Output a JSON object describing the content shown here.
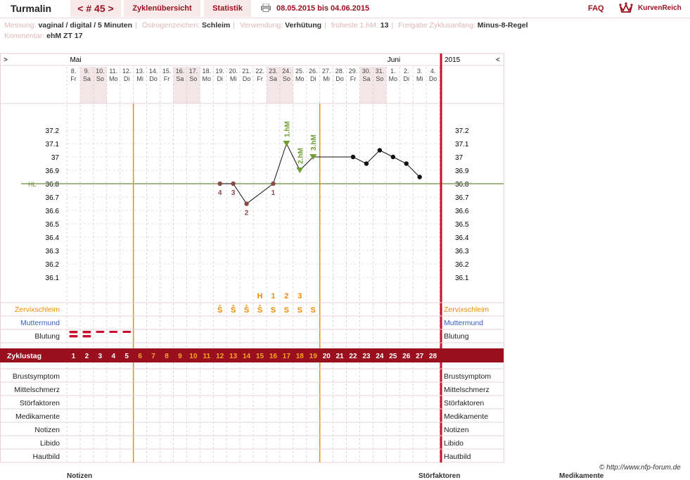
{
  "header": {
    "title": "Turmalin",
    "cycle_nav": "< # 45 >",
    "tab_overview": "Zyklenübersicht",
    "tab_stats": "Statistik",
    "date_range": "08.05.2015 bis 04.06.2015",
    "faq": "FAQ",
    "brand": "KurvenReich"
  },
  "info": {
    "messung_label": "Messung:",
    "messung_value": "vaginal / digital / 5 Minuten",
    "oestro_label": "Östrogenzeichen:",
    "oestro_value": "Schleim",
    "verw_label": "Verwendung:",
    "verw_value": "Verhütung",
    "hm_label": "früheste 1.hM:",
    "hm_value": "13",
    "freigabe_label": "Freigabe Zyklusanfang:",
    "freigabe_value": "Minus-8-Regel",
    "komm_label": "Kommentar:",
    "komm_value": "ehM ZT 17"
  },
  "chart_data": {
    "type": "line",
    "month_left": "Mai",
    "month_right": "Juni",
    "year": "2015",
    "nav_left": ">",
    "nav_right": "<",
    "days": [
      {
        "d": "8.",
        "w": "Fr"
      },
      {
        "d": "9.",
        "w": "Sa"
      },
      {
        "d": "10.",
        "w": "So"
      },
      {
        "d": "11.",
        "w": "Mo"
      },
      {
        "d": "12.",
        "w": "Di"
      },
      {
        "d": "13.",
        "w": "Mi"
      },
      {
        "d": "14.",
        "w": "Do"
      },
      {
        "d": "15.",
        "w": "Fr"
      },
      {
        "d": "16.",
        "w": "Sa"
      },
      {
        "d": "17.",
        "w": "So"
      },
      {
        "d": "18.",
        "w": "Mo"
      },
      {
        "d": "19.",
        "w": "Di"
      },
      {
        "d": "20.",
        "w": "Mi"
      },
      {
        "d": "21.",
        "w": "Do"
      },
      {
        "d": "22.",
        "w": "Fr"
      },
      {
        "d": "23.",
        "w": "Sa"
      },
      {
        "d": "24.",
        "w": "So"
      },
      {
        "d": "25.",
        "w": "Mo"
      },
      {
        "d": "26.",
        "w": "Di"
      },
      {
        "d": "27.",
        "w": "Mi"
      },
      {
        "d": "28.",
        "w": "Do"
      },
      {
        "d": "29.",
        "w": "Fr"
      },
      {
        "d": "30.",
        "w": "Sa"
      },
      {
        "d": "31.",
        "w": "So"
      },
      {
        "d": "1.",
        "w": "Mo"
      },
      {
        "d": "2.",
        "w": "Di"
      },
      {
        "d": "3.",
        "w": "Mi"
      },
      {
        "d": "4.",
        "w": "Do"
      }
    ],
    "weekend_days": [
      2,
      3,
      9,
      10,
      16,
      17,
      23,
      24
    ],
    "cycle_days": [
      1,
      2,
      3,
      4,
      5,
      6,
      7,
      8,
      9,
      10,
      11,
      12,
      13,
      14,
      15,
      16,
      17,
      18,
      19,
      20,
      21,
      22,
      23,
      24,
      25,
      26,
      27,
      28
    ],
    "ylim": [
      36.0,
      37.3
    ],
    "y_ticks": [
      "37.2",
      "37.1",
      "37",
      "36.9",
      "36.8",
      "36.7",
      "36.6",
      "36.5",
      "36.4",
      "36.3",
      "36.2",
      "36.1"
    ],
    "hl_label": "HL",
    "hl_value": 36.8,
    "temps": [
      {
        "cd": 12,
        "t": 36.8,
        "label": "4"
      },
      {
        "cd": 13,
        "t": 36.8,
        "label": "3"
      },
      {
        "cd": 14,
        "t": 36.65,
        "label": "2"
      },
      {
        "cd": 16,
        "t": 36.8,
        "label": "1"
      },
      {
        "cd": 17,
        "t": 37.1,
        "hm": "1.hM"
      },
      {
        "cd": 18,
        "t": 36.9,
        "hm": "2.hM"
      },
      {
        "cd": 19,
        "t": 37.0,
        "hm": "3.hM"
      },
      {
        "cd": 22,
        "t": 37.0
      },
      {
        "cd": 23,
        "t": 36.95
      },
      {
        "cd": 24,
        "t": 37.05
      },
      {
        "cd": 25,
        "t": 37.0
      },
      {
        "cd": 26,
        "t": 36.95
      },
      {
        "cd": 27,
        "t": 36.85
      }
    ],
    "mucus_marks": [
      {
        "cd": 15,
        "text": "H"
      },
      {
        "cd": 16,
        "text": "1"
      },
      {
        "cd": 17,
        "text": "2"
      },
      {
        "cd": 18,
        "text": "3"
      }
    ],
    "mucus_symbols": [
      {
        "cd": 12,
        "text": "S",
        "plus": true
      },
      {
        "cd": 13,
        "text": "S",
        "plus": true
      },
      {
        "cd": 14,
        "text": "S",
        "plus": true
      },
      {
        "cd": 15,
        "text": "S",
        "plus": true
      },
      {
        "cd": 16,
        "text": "S"
      },
      {
        "cd": 17,
        "text": "S"
      },
      {
        "cd": 18,
        "text": "S"
      },
      {
        "cd": 19,
        "text": "S"
      }
    ],
    "bleeding": [
      {
        "cd": 1,
        "level": 2
      },
      {
        "cd": 2,
        "level": 2
      },
      {
        "cd": 3,
        "level": 1
      },
      {
        "cd": 4,
        "level": 1
      },
      {
        "cd": 5,
        "level": 1
      }
    ],
    "orange_day_start": 6,
    "orange_day_end": 19,
    "row_labels": {
      "zervix": "Zervixschleim",
      "muttermund": "Muttermund",
      "blutung": "Blutung",
      "zyklustag": "Zyklustag",
      "brust": "Brustsymptom",
      "mittel": "Mittelschmerz",
      "stoer": "Störfaktoren",
      "medi": "Medikamente",
      "notizen": "Notizen",
      "libido": "Libido",
      "haut": "Hautbild"
    },
    "colors": {
      "accent": "#9a0f1e",
      "orange": "#f08a00",
      "hl": "#6b8e3a",
      "weekend": "#f3e6e8",
      "muttermund": "#3a5fbf"
    }
  },
  "footer": {
    "copyright": "© http://www.nfp-forum.de",
    "bottom_notizen": "Notizen",
    "bottom_stoer": "Störfaktoren",
    "bottom_medi": "Medikamente"
  }
}
